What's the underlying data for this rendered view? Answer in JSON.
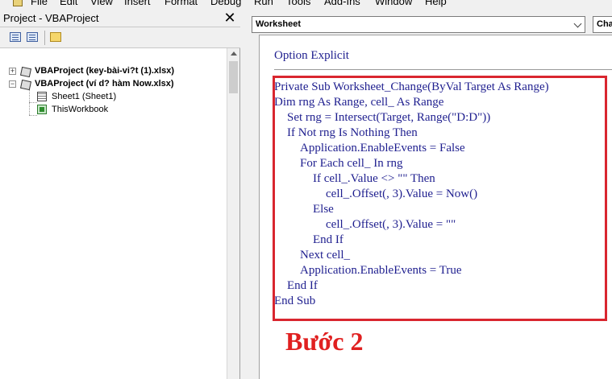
{
  "menu": {
    "items": [
      "File",
      "Edit",
      "View",
      "Insert",
      "Format",
      "Debug",
      "Run",
      "Tools",
      "Add-Ins",
      "Window",
      "Help"
    ]
  },
  "project_explorer": {
    "title": "Project - VBAProject",
    "close_glyph": "✕",
    "tree": [
      {
        "label": "VBAProject (key-bài-vi?t (1).xlsx)",
        "bold": true,
        "expanded": false,
        "kind": "project"
      },
      {
        "label": "VBAProject (ví d? hàm Now.xlsx)",
        "bold": true,
        "expanded": true,
        "kind": "project"
      },
      {
        "label": "Sheet1 (Sheet1)",
        "bold": false,
        "kind": "sheet"
      },
      {
        "label": "ThisWorkbook",
        "bold": false,
        "kind": "workbook"
      }
    ]
  },
  "code_window": {
    "object_combo": "Worksheet",
    "proc_combo": "Cha",
    "declarations": "Option Explicit",
    "code_lines": [
      "Private Sub Worksheet_Change(ByVal Target As Range)",
      "Dim rng As Range, cell_ As Range",
      "Set rng = Intersect(Target, Range(\"D:D\"))",
      "If Not rng Is Nothing Then",
      "Application.EnableEvents = False",
      "For Each cell_ In rng",
      "If cell_.Value <> \"\" Then",
      "cell_.Offset(, 3).Value = Now()",
      "Else",
      "cell_.Offset(, 3).Value = \"\"",
      "End If",
      "Next cell_",
      "Application.EnableEvents = True",
      "End If",
      "End Sub"
    ],
    "step_label": "Bước 2"
  },
  "colors": {
    "highlight_border": "#d9262f",
    "step_label": "#e02020",
    "code_text": "#1f1f8f"
  }
}
